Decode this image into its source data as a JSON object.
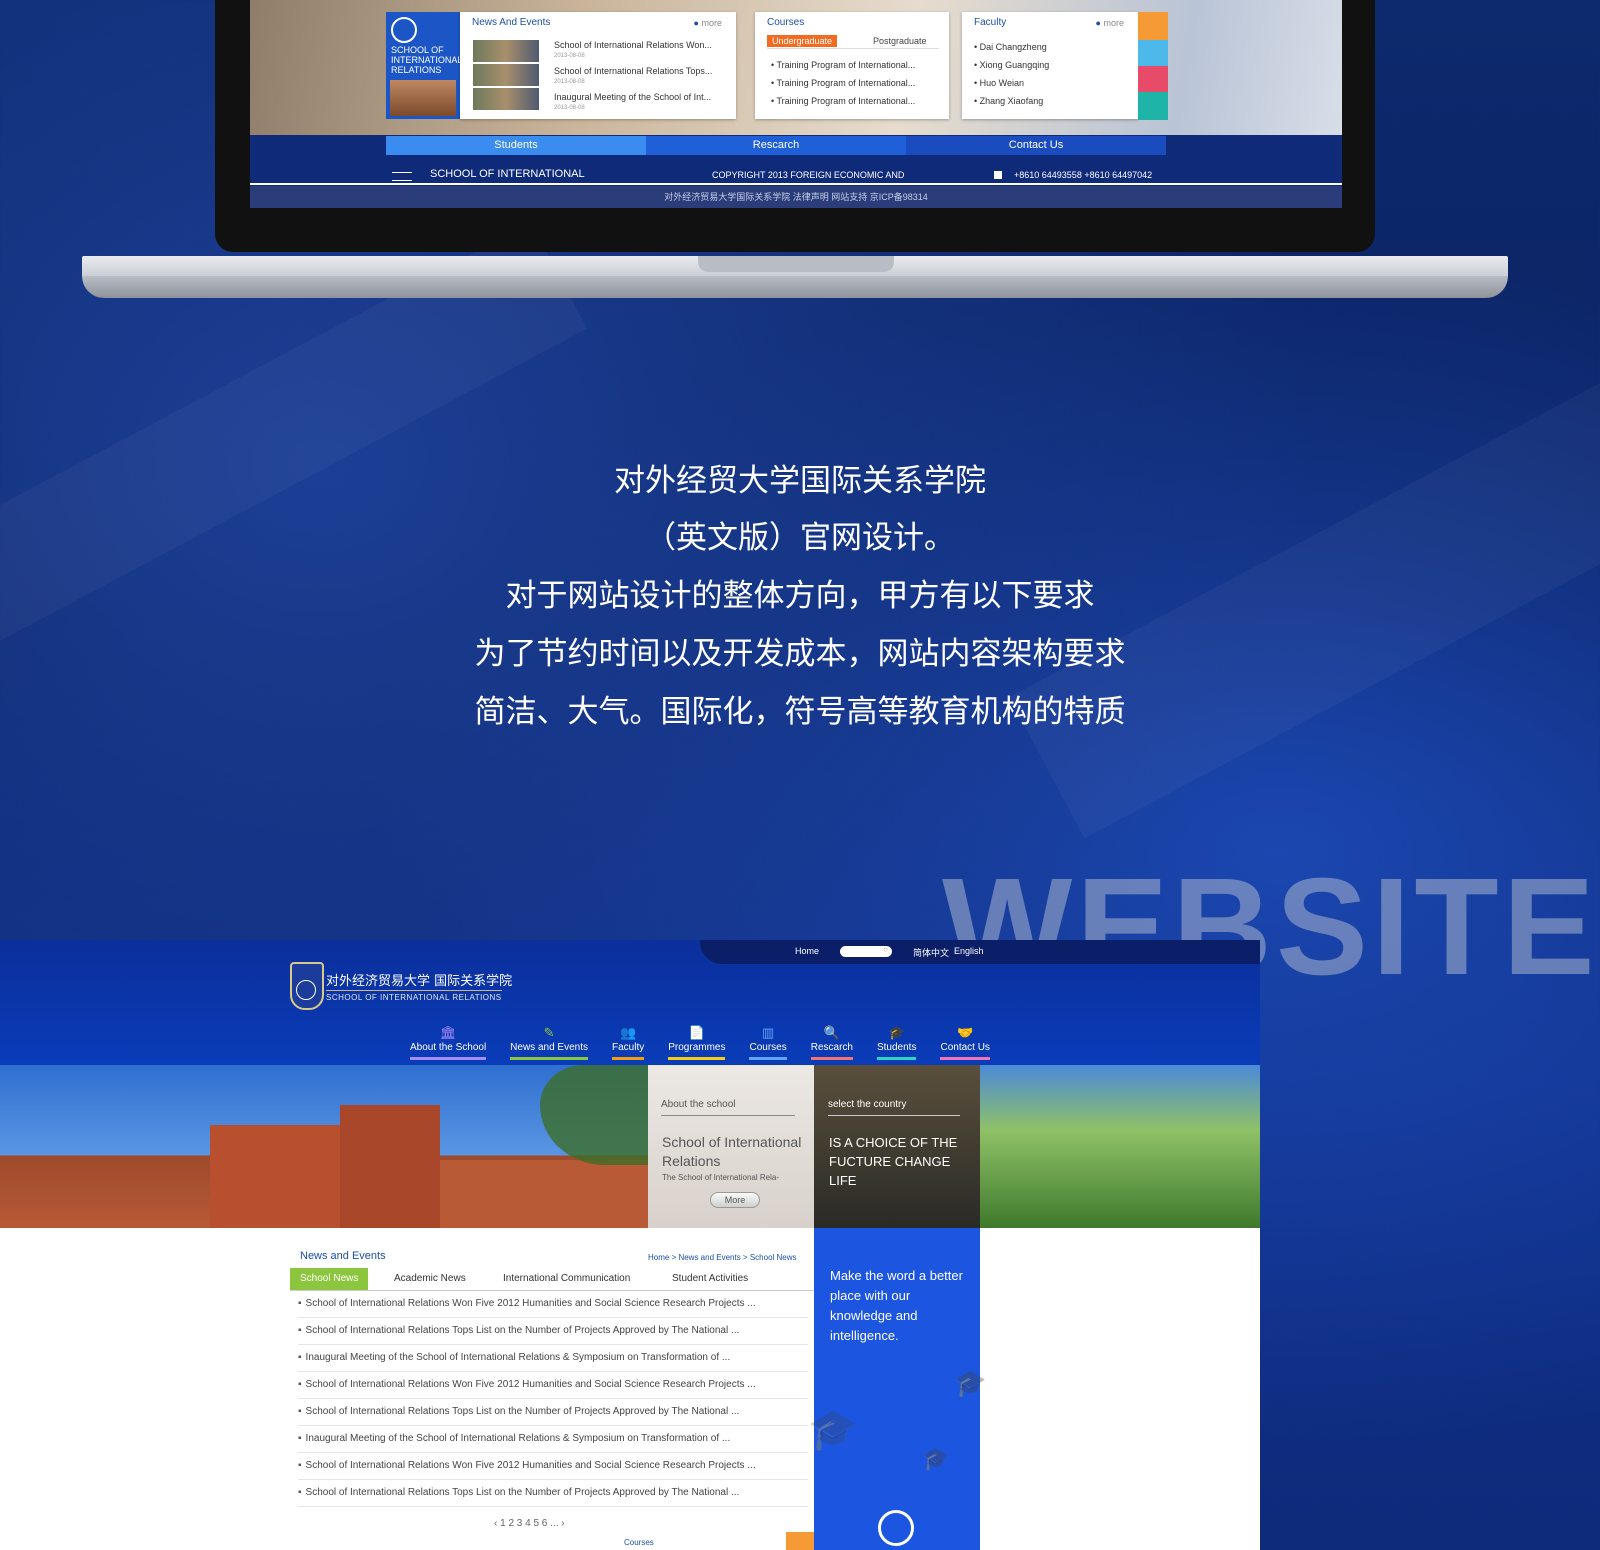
{
  "laptop": {
    "news_events": {
      "title": "News And Events",
      "more": "more",
      "items": [
        {
          "title": "School of International Relations Won...",
          "date": "2013-08-08"
        },
        {
          "title": "School of International Relations Tops...",
          "date": "2013-08-08"
        },
        {
          "title": "Inaugural Meeting of the School of Int...",
          "date": "2013-08-08"
        }
      ]
    },
    "badge": {
      "line1": "SCHOOL OF",
      "line2": "INTERNATIONAL",
      "line3": "RELATIONS"
    },
    "courses": {
      "title": "Courses",
      "tab_active": "Undergraduate",
      "tab_other": "Postgraduate",
      "items": [
        "Training Program of International...",
        "Training Program of International...",
        "Training Program of International..."
      ]
    },
    "faculty": {
      "title": "Faculty",
      "more": "more",
      "items": [
        "Dai Changzheng",
        "Xiong Guangqing",
        "Huo Weian",
        "Zhang Xiaofang"
      ]
    },
    "nav": [
      "Students",
      "Rescarch",
      "Contact Us"
    ],
    "footer": {
      "school": "SCHOOL OF INTERNATIONAL",
      "copyright": "COPYRIGHT 2013 FOREIGN ECONOMIC AND",
      "phones": "+8610 64493558    +8610 64497042",
      "bottom": "对外经济贸易大学国际关系学院    法律声明    网站支持  京ICP备98314"
    }
  },
  "intro": {
    "lines": [
      "对外经贸大学国际关系学院",
      "（英文版）官网设计。",
      "对于网站设计的整体方向，甲方有以下要求",
      "为了节约时间以及开发成本，网站内容架构要求",
      "简洁、大气。国际化，符号高等教育机构的特质"
    ],
    "watermark": "WEBSITE"
  },
  "site": {
    "topbar": {
      "home": "Home",
      "lang_cn": "简体中文",
      "lang_en": "English"
    },
    "logo": {
      "cn": "对外经济贸易大学 国际关系学院",
      "en": "SCHOOL OF INTERNATIONAL RELATIONS"
    },
    "nav": [
      {
        "label": "About the School",
        "icon": "🏛",
        "color": "#a78bfa"
      },
      {
        "label": "News and Events",
        "icon": "✎",
        "color": "#8cc63f"
      },
      {
        "label": "Faculty",
        "icon": "👥",
        "color": "#f59e0b"
      },
      {
        "label": "Programmes",
        "icon": "📄",
        "color": "#facc15"
      },
      {
        "label": "Courses",
        "icon": "▥",
        "color": "#60a5fa"
      },
      {
        "label": "Rescarch",
        "icon": "🔍",
        "color": "#f87171"
      },
      {
        "label": "Students",
        "icon": "🎓",
        "color": "#2dd4bf"
      },
      {
        "label": "Contact Us",
        "icon": "🤝",
        "color": "#f472b6"
      }
    ],
    "about_card": {
      "kicker": "About the school",
      "title": "School of International Relations",
      "desc": "The School of International Rela-",
      "button": "More"
    },
    "country_card": {
      "kicker": "select the country",
      "title": "IS A CHOICE OF THE FUCTURE CHANGE LIFE"
    },
    "news": {
      "title": "News and Events",
      "breadcrumb": "Home > News and Events > School News",
      "tabs": [
        "School News",
        "Academic News",
        "International Communication",
        "Student Activities"
      ],
      "items": [
        "School of International Relations Won Five 2012 Humanities and Social Science Research Projects  ...",
        "School of International Relations Tops List on the Number of Projects Approved by The National ...",
        "Inaugural Meeting of the School of International Relations & Symposium on Transformation of ...",
        "School of International Relations Won Five 2012 Humanities and Social Science Research Projects  ...",
        "School of International Relations Tops List on the Number of Projects Approved by The National ...",
        "Inaugural Meeting of the School of International Relations & Symposium on Transformation of ...",
        "School of International Relations Won Five 2012 Humanities and Social Science Research Projects  ...",
        "School of International Relations Tops List on the Number of Projects Approved by The National ..."
      ],
      "pager": "‹ 1 2 3 4 5 6 ... ›",
      "footer_label": "Courses"
    },
    "side_panel": {
      "text": "Make the word a better place with our knowledge and intelligence."
    }
  }
}
